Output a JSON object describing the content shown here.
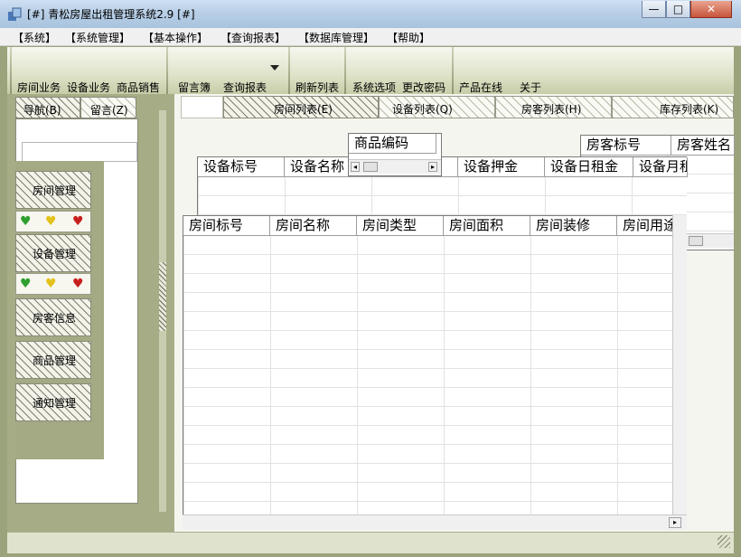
{
  "window": {
    "title": "[#] 青松房屋出租管理系统2.9 [#]",
    "minimize": "—",
    "maximize": "□",
    "close": "✕"
  },
  "menu": [
    "【系统】",
    "【系统管理】",
    "【基本操作】",
    "【查询报表】",
    "【数据库管理】",
    "【帮助】"
  ],
  "toolbar": {
    "room_business": "房间业务",
    "equipment_business": "设备业务",
    "goods_sales": "商品销售",
    "message_book": "留言簿",
    "query_report": "查询报表",
    "refresh_list": "刷新列表",
    "system_options": "系统选项",
    "change_password": "更改密码",
    "products_online": "产品在线",
    "about": "关于"
  },
  "left_tabs": [
    "导航(B)",
    "留言(Z)"
  ],
  "main_tabs": [
    "房间列表(E)",
    "设备列表(Q)",
    "房客列表(H)",
    "库存列表(K)"
  ],
  "nav": {
    "room_management": "房间管理",
    "equipment_management": "设备管理",
    "tenant_info": "房客信息",
    "goods_management": "商品管理",
    "notice_management": "通知管理"
  },
  "goods_table": {
    "headers": [
      "商品编码"
    ]
  },
  "tenant_table": {
    "headers": [
      "房客标号",
      "房客姓名"
    ]
  },
  "equipment_table": {
    "headers": [
      "设备标号",
      "设备名称",
      "",
      "设备押金",
      "设备日租金",
      "设备月租"
    ]
  },
  "room_table": {
    "headers": [
      "房间标号",
      "房间名称",
      "房间类型",
      "房间面积",
      "房间装修",
      "房间用途"
    ]
  },
  "colors": {
    "green": "#2e9f2e",
    "yellow": "#e3c21a",
    "red": "#c81e1e",
    "frame": "#9aa37c"
  }
}
